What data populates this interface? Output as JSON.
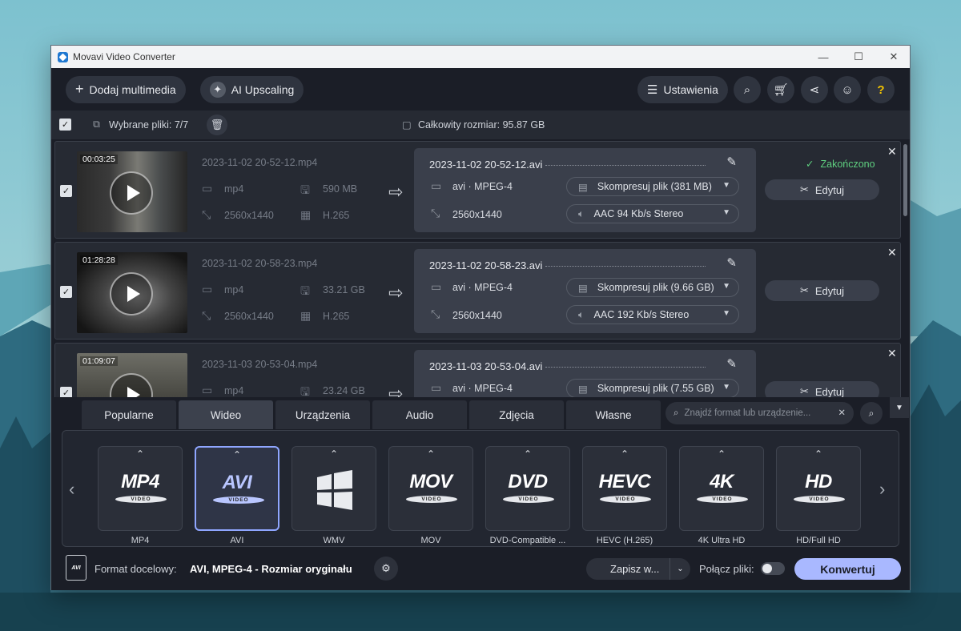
{
  "window": {
    "title": "Movavi Video Converter",
    "minimize": "—",
    "maximize": "☐",
    "close": "✕"
  },
  "toolbar": {
    "add_media": "Dodaj multimedia",
    "ai_upscaling": "AI Upscaling",
    "settings": "Ustawienia"
  },
  "selection": {
    "selected_label": "Wybrane pliki: 7/7",
    "total_size": "Całkowity rozmiar: 95.87 GB"
  },
  "files": [
    {
      "duration": "00:03:25",
      "source_name": "2023-11-02 20-52-12.mp4",
      "src_format": "mp4",
      "src_size": "590 MB",
      "src_resolution": "2560x1440",
      "src_codec": "H.265",
      "output_name": "2023-11-02 20-52-12.avi",
      "out_format": "avi · MPEG-4",
      "out_resolution": "2560x1440",
      "compress": "Skompresuj plik (381 MB)",
      "audio": "AAC 94 Kb/s Stereo",
      "status": "Zakończono",
      "edit": "Edytuj"
    },
    {
      "duration": "01:28:28",
      "source_name": "2023-11-02 20-58-23.mp4",
      "src_format": "mp4",
      "src_size": "33.21 GB",
      "src_resolution": "2560x1440",
      "src_codec": "H.265",
      "output_name": "2023-11-02 20-58-23.avi",
      "out_format": "avi · MPEG-4",
      "out_resolution": "2560x1440",
      "compress": "Skompresuj plik (9.66 GB)",
      "audio": "AAC 192 Kb/s Stereo",
      "status": "",
      "edit": "Edytuj"
    },
    {
      "duration": "01:09:07",
      "source_name": "2023-11-03 20-53-04.mp4",
      "src_format": "mp4",
      "src_size": "23.24 GB",
      "src_resolution": "",
      "src_codec": "",
      "output_name": "2023-11-03 20-53-04.avi",
      "out_format": "avi · MPEG-4",
      "out_resolution": "",
      "compress": "Skompresuj plik (7.55 GB)",
      "audio": "",
      "status": "",
      "edit": "Edytuj"
    }
  ],
  "tabs": [
    "Popularne",
    "Wideo",
    "Urządzenia",
    "Audio",
    "Zdjęcia",
    "Własne"
  ],
  "active_tab": "Wideo",
  "search": {
    "placeholder": "Znajdź format lub urządzenie..."
  },
  "formats": [
    {
      "logo": "MP4",
      "disc": "VIDEO",
      "label": "MP4"
    },
    {
      "logo": "AVI",
      "disc": "VIDEO",
      "label": "AVI"
    },
    {
      "logo": "",
      "disc": "",
      "label": "WMV"
    },
    {
      "logo": "MOV",
      "disc": "VIDEO",
      "label": "MOV"
    },
    {
      "logo": "DVD",
      "disc": "VIDEO",
      "label": "DVD-Compatible ..."
    },
    {
      "logo": "HEVC",
      "disc": "VIDEO",
      "label": "HEVC (H.265)"
    },
    {
      "logo": "4K",
      "disc": "VIDEO",
      "label": "4K Ultra HD"
    },
    {
      "logo": "HD",
      "disc": "VIDEO",
      "label": "HD/Full HD"
    }
  ],
  "selected_format": "AVI",
  "footer": {
    "target_label": "Format docelowy:",
    "target_value": "AVI, MPEG-4 - Rozmiar oryginału",
    "save_to": "Zapisz w...",
    "merge_label": "Połącz pliki:",
    "convert": "Konwertuj",
    "badge": "AVI"
  },
  "colors": {
    "accent": "#a9b8ff",
    "done": "#5fd080",
    "bg": "#1b1e27"
  }
}
